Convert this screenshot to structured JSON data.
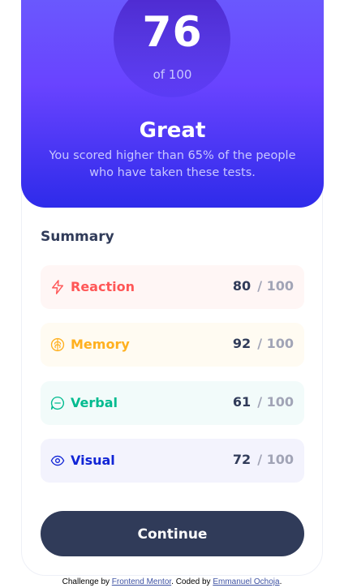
{
  "result": {
    "score": "76",
    "of_label": "of 100",
    "rating": "Great",
    "description": "You scored higher than 65% of the people who have taken these tests."
  },
  "summary": {
    "title": "Summary",
    "items": [
      {
        "label": "Reaction",
        "score": "80",
        "max": "/ 100",
        "icon": "lightning-icon",
        "color": "#ff5757",
        "bg": "#fff6f5"
      },
      {
        "label": "Memory",
        "score": "92",
        "max": "/ 100",
        "icon": "brain-icon",
        "color": "#ffb01f",
        "bg": "#fffbf2"
      },
      {
        "label": "Verbal",
        "score": "61",
        "max": "/ 100",
        "icon": "chat-bubble-icon",
        "color": "#00bb8f",
        "bg": "#f2fbfa"
      },
      {
        "label": "Visual",
        "score": "72",
        "max": "/ 100",
        "icon": "eye-icon",
        "color": "#1125d6",
        "bg": "#f3f3fd"
      }
    ]
  },
  "continue_label": "Continue",
  "attribution": {
    "prefix": "Challenge by ",
    "challenge_link": "Frontend Mentor",
    "middle": ". Coded by ",
    "author_link": "Emmanuel Ochoja",
    "suffix": "."
  }
}
